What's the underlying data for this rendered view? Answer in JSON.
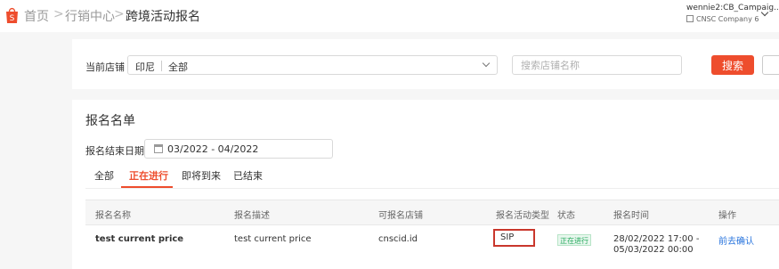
{
  "header": {
    "breadcrumb": [
      "首页",
      "行销中心",
      "跨境活动报名"
    ],
    "separator": ">",
    "account": "wennie2:CB_Campaig...",
    "company": "CNSC Company 6"
  },
  "filter": {
    "label": "当前店铺",
    "country": "印尼",
    "shop_value": "全部",
    "search_placeholder": "搜索店铺名称",
    "search_button": "搜索"
  },
  "list": {
    "title": "报名名单",
    "date_label": "报名结束日期",
    "date_range": "03/2022 - 04/2022",
    "tabs": [
      "全部",
      "正在进行",
      "即将到来",
      "已结束"
    ],
    "active_tab": "正在进行",
    "columns": [
      "报名名称",
      "报名描述",
      "可报名店铺",
      "报名活动类型",
      "状态",
      "报名时间",
      "操作"
    ],
    "rows": [
      {
        "name": "test current price",
        "description": "test current price",
        "shop": "cnscid.id",
        "type": "SIP",
        "status": "正在进行",
        "time_start": "28/02/2022 17:00 -",
        "time_end": "05/03/2022 00:00",
        "action": "前去确认"
      }
    ]
  },
  "colors": {
    "accent": "#ee4d2d",
    "link": "#2673dd",
    "status_green": "#26aa5d"
  }
}
